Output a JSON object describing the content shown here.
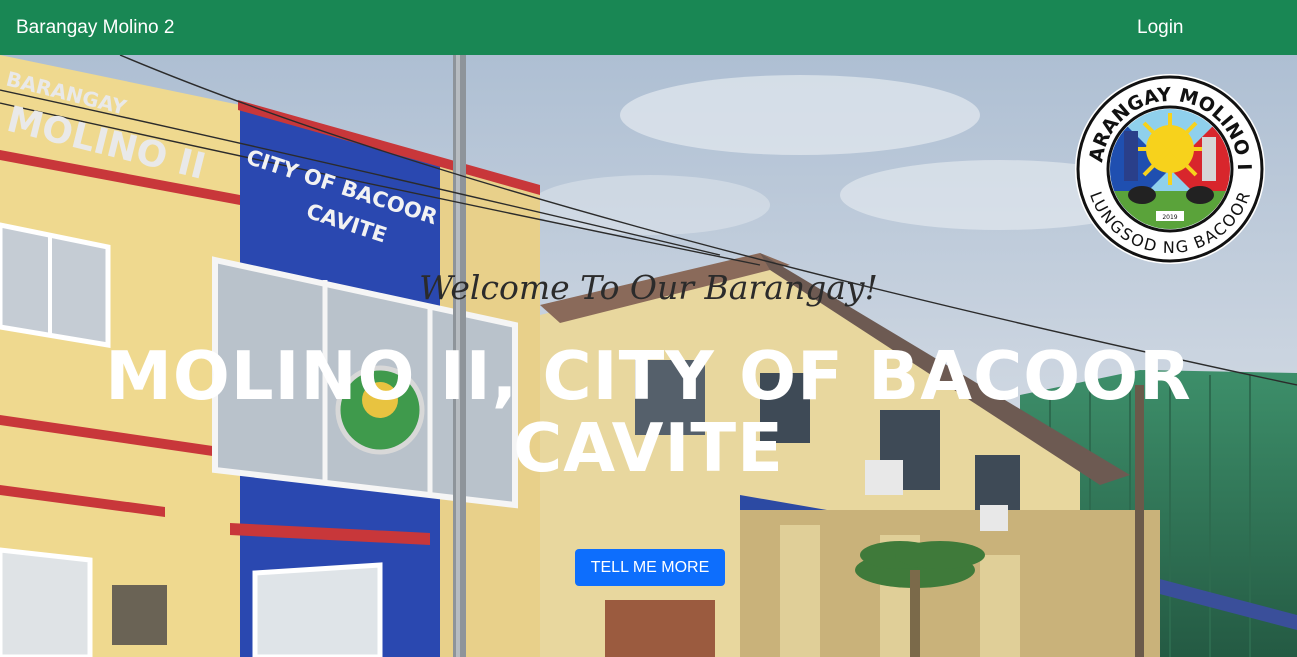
{
  "navbar": {
    "brand": "Barangay Molino 2",
    "login": "Login",
    "color": "#198754"
  },
  "hero": {
    "background_image": "barangay-hall-photo",
    "building_signs": {
      "sign_barangay_line1": "BARANGAY",
      "sign_barangay_line2": "MOLINO II",
      "sign_city_line1": "CITY OF BACOOR",
      "sign_city_line2": "CAVITE"
    },
    "welcome": "Welcome To Our Barangay!",
    "headline": "MOLINO II, CITY OF BACOOR CAVITE",
    "cta_label": "TELL ME MORE",
    "cta_color": "#0d6efd"
  },
  "seal": {
    "top_text": "BARANGAY MOLINO II",
    "bottom_text": "LUNGSOD NG BACOOR",
    "year": "2019"
  }
}
